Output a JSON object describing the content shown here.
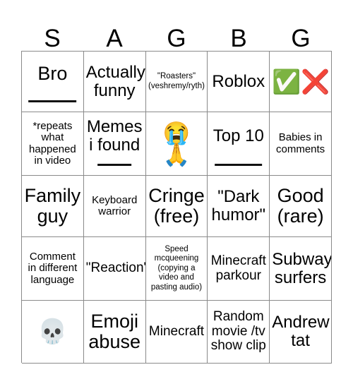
{
  "card": {
    "header_letters": [
      "S",
      "A",
      "G",
      "B",
      "G"
    ],
    "rows": [
      [
        {
          "text": "Bro",
          "size": "size-xl",
          "rule": "rule-wide"
        },
        {
          "text": "Actually\nfunny",
          "size": "size-lg"
        },
        {
          "text": "\"Roasters\"\n(veshremy/ryth)",
          "size": "size-xs"
        },
        {
          "text": "Roblox",
          "size": "size-lg"
        },
        {
          "text": "✅❌",
          "size": "emoji-row",
          "kind": "emoji"
        }
      ],
      [
        {
          "text": "*repeats\nwhat\nhappened\nin video",
          "size": "size-sm"
        },
        {
          "text": "Memes\ni found",
          "size": "size-lg",
          "rule": "rule-narrow"
        },
        {
          "text": "😭\n🙏",
          "size": "emoji-stack",
          "kind": "emoji"
        },
        {
          "text": "Top 10",
          "size": "size-lg",
          "rule": "rule-wide"
        },
        {
          "text": "Babies in\ncomments",
          "size": "size-sm"
        }
      ],
      [
        {
          "text": "Family\nguy",
          "size": "size-xl"
        },
        {
          "text": "Keyboard\nwarrior",
          "size": "size-sm"
        },
        {
          "text": "Cringe\n(free)",
          "size": "size-xl"
        },
        {
          "text": "\"Dark\nhumor\"",
          "size": "size-lg"
        },
        {
          "text": "Good\n(rare)",
          "size": "size-xl"
        }
      ],
      [
        {
          "text": "Comment\nin different\nlanguage",
          "size": "size-sm"
        },
        {
          "text": "\"Reaction\"",
          "size": "size-md"
        },
        {
          "text": "Speed\nmcqueening\n(copying a\nvideo and\npasting audio)",
          "size": "size-xs"
        },
        {
          "text": "Minecraft\nparkour",
          "size": "size-md"
        },
        {
          "text": "Subway\nsurfers",
          "size": "size-lg"
        }
      ],
      [
        {
          "text": "💀",
          "size": "emoji-single",
          "kind": "emoji"
        },
        {
          "text": "Emoji\nabuse",
          "size": "size-xl"
        },
        {
          "text": "Minecraft",
          "size": "size-md"
        },
        {
          "text": "Random\nmovie /tv\nshow clip",
          "size": "size-md"
        },
        {
          "text": "Andrew\ntat",
          "size": "size-lg"
        }
      ]
    ]
  }
}
